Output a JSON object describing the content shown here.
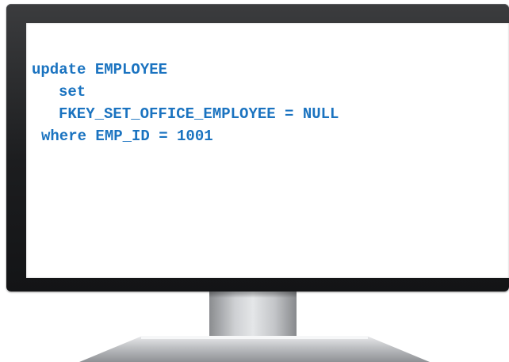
{
  "code": {
    "lines": [
      "update EMPLOYEE",
      "set",
      "FKEY_SET_OFFICE_EMPLOYEE = NULL",
      "where EMP_ID = 1001"
    ]
  },
  "colors": {
    "code_text": "#1a73c0",
    "bezel": "#1c1d1f",
    "screen": "#ffffff",
    "stand": "#c3c5c8"
  },
  "icons": [
    "monitor-icon"
  ]
}
